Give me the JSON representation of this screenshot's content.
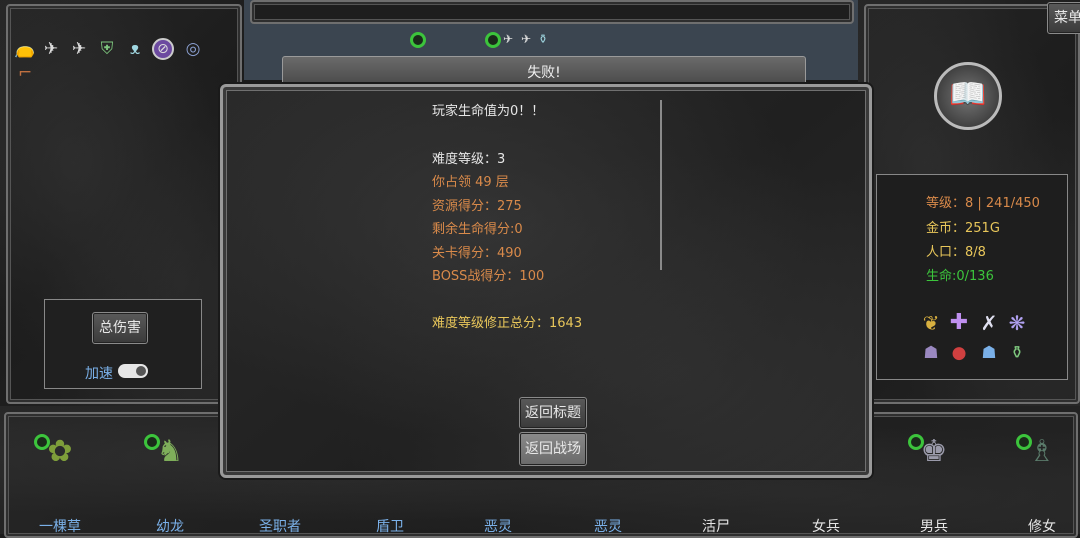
{
  "colors": {
    "accent_orange": "#d98a4a",
    "gold": "#e8c65a",
    "green": "#3cc43c",
    "blue_label": "#7ab0e8",
    "white": "#e6e6e6"
  },
  "menu_label": "菜单",
  "top_bar": {
    "title": "失败!"
  },
  "inventory": {
    "icons": [
      "sack-icon",
      "feather-icon",
      "feather-icon",
      "shield-icon",
      "amulet-icon",
      "cancel-orb-icon",
      "ring-icon",
      "boot-icon"
    ]
  },
  "top_status_icons": [
    "feather-icon",
    "feather-icon",
    "potion-icon"
  ],
  "left_panel": {
    "damage_button": "总伤害",
    "speed_label": "加速"
  },
  "result": {
    "title": "玩家生命值为0！！",
    "difficulty": "难度等级：3",
    "floor": "你占领 49 层",
    "resource": "资源得分：275",
    "life": "剩余生命得分:0",
    "stage": "关卡得分：490",
    "boss": "BOSS战得分：100",
    "total": "难度等级修正总分：1643",
    "btn_title": "返回标题",
    "btn_battle": "返回战场"
  },
  "stats": {
    "level": "等级：8 | 241/450",
    "gold": "金币：251G",
    "population": "人口：8/8",
    "life": "生命:0/136"
  },
  "skills": [
    "wheat-icon",
    "holy-cross-icon",
    "blade-icon",
    "slash-icon",
    "ghost-icon",
    "bomb-icon",
    "mana-icon",
    "elixir-icon"
  ],
  "units": [
    {
      "name": "一棵草",
      "ring": true
    },
    {
      "name": "幼龙",
      "ring": true
    },
    {
      "name": "圣职者",
      "ring": false
    },
    {
      "name": "盾卫",
      "ring": false
    },
    {
      "name": "恶灵",
      "ring": false
    },
    {
      "name": "恶灵",
      "ring": false
    },
    {
      "name": "活尸",
      "ring": false
    },
    {
      "name": "女兵",
      "ring": false
    },
    {
      "name": "男兵",
      "ring": true
    },
    {
      "name": "修女",
      "ring": true
    }
  ]
}
